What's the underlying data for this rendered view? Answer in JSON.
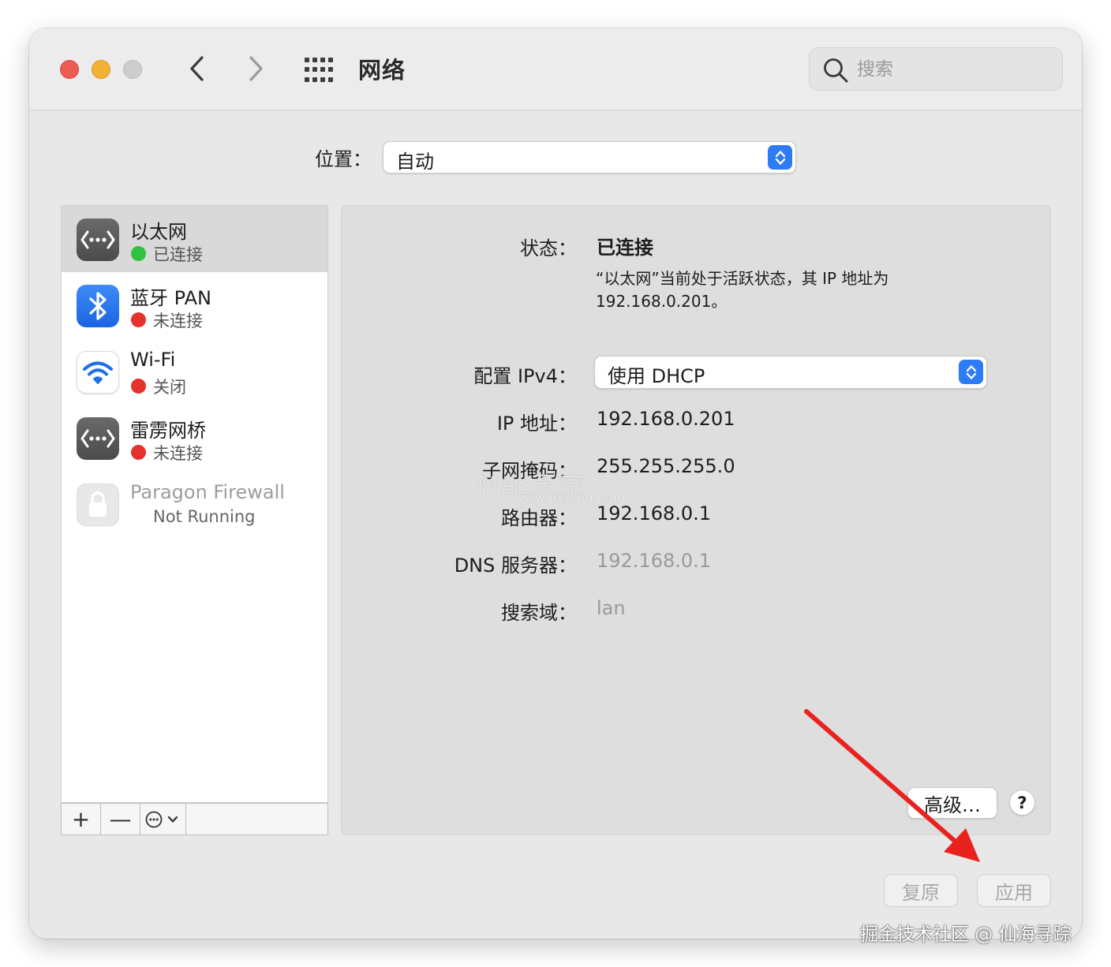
{
  "window": {
    "title": "网络",
    "search_placeholder": "搜索"
  },
  "location": {
    "label": "位置：",
    "value": "自动"
  },
  "sidebar": {
    "services": [
      {
        "name": "以太网",
        "status": "已连接",
        "status_color": "#2fc140",
        "icon": "ethernet-icon"
      },
      {
        "name": "蓝牙 PAN",
        "status": "未连接",
        "status_color": "#e5322d",
        "icon": "bluetooth-icon"
      },
      {
        "name": "Wi-Fi",
        "status": "关闭",
        "status_color": "#e5322d",
        "icon": "wifi-icon"
      },
      {
        "name": "雷雳网桥",
        "status": "未连接",
        "status_color": "#e5322d",
        "icon": "thunderbolt-bridge-icon"
      },
      {
        "name": "Paragon Firewall",
        "status": "Not Running",
        "icon": "lock-icon"
      }
    ],
    "toolbar": {
      "add": "+",
      "remove": "—"
    }
  },
  "detail": {
    "status_label": "状态：",
    "status_value": "已连接",
    "status_description": "“以太网”当前处于活跃状态，其 IP 地址为 192.168.0.201。",
    "ipv4_label": "配置 IPv4：",
    "ipv4_value": "使用 DHCP",
    "ip_label": "IP 地址：",
    "ip_value": "192.168.0.201",
    "subnet_label": "子网掩码：",
    "subnet_value": "255.255.255.0",
    "router_label": "路由器：",
    "router_value": "192.168.0.1",
    "dns_label": "DNS 服务器：",
    "dns_value": "192.168.0.1",
    "search_domain_label": "搜索域：",
    "search_domain_value": "lan",
    "advanced_button": "高级…",
    "help_button": "?"
  },
  "footer": {
    "revert": "复原",
    "apply": "应用"
  },
  "overlay": {
    "watermark": "Mac天空",
    "watermark_url": "www.mac69.com",
    "credit": "掘金技术社区 @ 仙海寻踪"
  },
  "colors": {
    "accent": "#2e7bf6",
    "arrow": "#e8231f"
  }
}
